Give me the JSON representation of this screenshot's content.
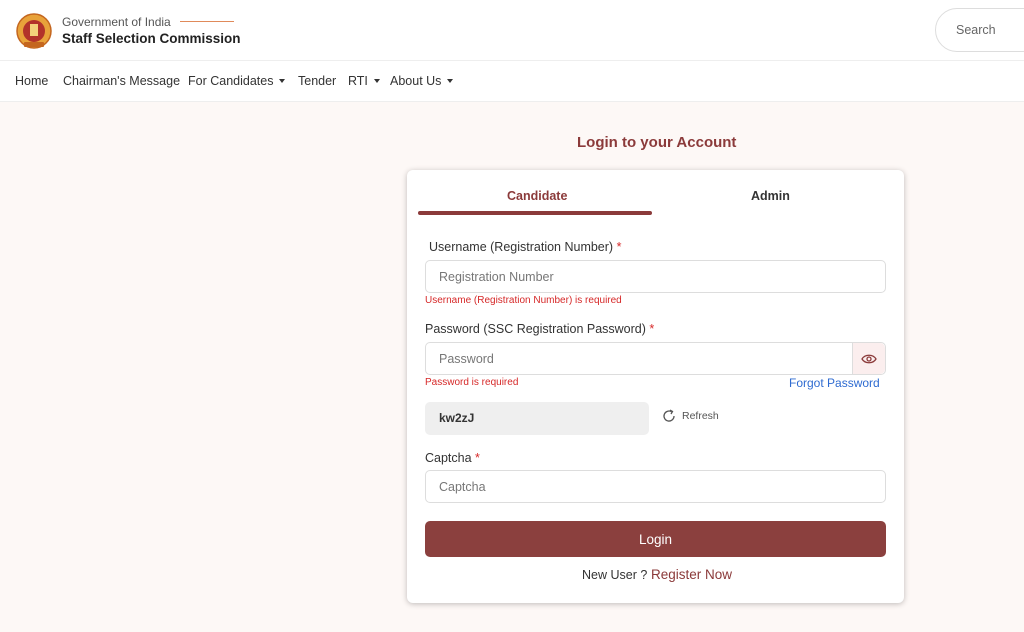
{
  "header": {
    "gov_label": "Government of India",
    "org_name": "Staff Selection Commission",
    "search_placeholder": "Search"
  },
  "nav": {
    "home": "Home",
    "chairman": "Chairman's Message",
    "candidates": "For Candidates",
    "tender": "Tender",
    "rti": "RTI",
    "about": "About Us"
  },
  "login": {
    "title": "Login to your Account",
    "tabs": {
      "candidate": "Candidate",
      "admin": "Admin"
    },
    "username_label": "Username (Registration Number)",
    "username_placeholder": "Registration Number",
    "username_error": "Username (Registration Number) is required",
    "password_label": "Password (SSC Registration Password)",
    "password_placeholder": "Password",
    "password_error": "Password is required",
    "forgot": "Forgot Password",
    "captcha_code": "kw2zJ",
    "refresh": "Refresh",
    "captcha_label": "Captcha",
    "captcha_placeholder": "Captcha",
    "login_button": "Login",
    "new_user": "New User ?",
    "register": "Register Now",
    "required_mark": "*"
  },
  "colors": {
    "brand": "#8b3a3a",
    "error": "#d62828",
    "link": "#2e6bd1"
  }
}
